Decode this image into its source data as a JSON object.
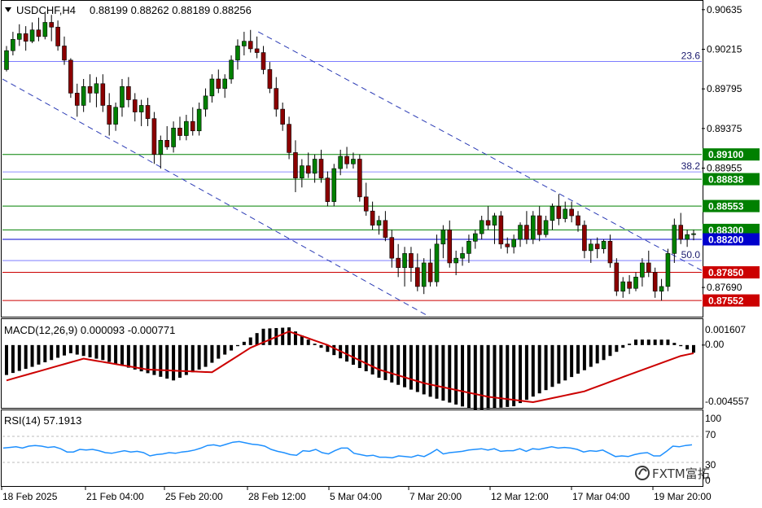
{
  "header": {
    "symbol": "USDCHF,H4",
    "ohlc": "0.88199 0.88262 0.88189 0.88256"
  },
  "macd_panel": {
    "title": "MACD(12,26,9) 0.000093 -0.000771",
    "axis_labels": [
      "0.001607",
      "0.00",
      "-0.004557"
    ]
  },
  "rsi_panel": {
    "title": "RSI(14) 57.1913",
    "axis_labels": [
      "100",
      "70",
      "30",
      "0"
    ]
  },
  "watermark": {
    "text": "FXTM富拓",
    "icon": "fxtm-logo-icon"
  },
  "colors": {
    "bull": "#008000",
    "bear": "#8b0000",
    "green_level": "#008000",
    "red_level": "#cc0000",
    "blue_level": "#0000cc",
    "macd_signal": "#cc0000",
    "rsi_line": "#1e90ff",
    "channel": "#2b3bb5"
  },
  "chart_data": [
    {
      "type": "candlestick",
      "title": "USDCHF,H4",
      "ylim": [
        0.8738,
        0.9072
      ],
      "price_ticks": [
        "0.90635",
        "0.90215",
        "0.89795",
        "0.89375",
        "0.88955",
        "0.87690"
      ],
      "time_labels": [
        "18 Feb 2025",
        "21 Feb 04:00",
        "25 Feb 20:00",
        "28 Feb 12:00",
        "5 Mar 04:00",
        "7 Mar 20:00",
        "12 Mar 12:00",
        "17 Mar 04:00",
        "19 Mar 20:00"
      ],
      "level_tags": [
        {
          "label": "0.89100",
          "value": 0.891,
          "color": "green"
        },
        {
          "label": "0.88838",
          "value": 0.88838,
          "color": "green"
        },
        {
          "label": "0.88553",
          "value": 0.88553,
          "color": "green"
        },
        {
          "label": "0.88300",
          "value": 0.883,
          "color": "green"
        },
        {
          "label": "0.88200",
          "value": 0.882,
          "color": "blue"
        },
        {
          "label": "0.87850",
          "value": 0.8785,
          "color": "red"
        },
        {
          "label": "0.87552",
          "value": 0.87552,
          "color": "red"
        }
      ],
      "fibonacci": [
        {
          "label": "23.6",
          "value": 0.90085
        },
        {
          "label": "38.2",
          "value": 0.88915
        },
        {
          "label": "50.0",
          "value": 0.87975
        }
      ],
      "channel_lines": [
        {
          "x1": 0.0,
          "y1": 0.899,
          "x2": 0.6105,
          "y2": 0.8738
        },
        {
          "x1": 0.3658,
          "y1": 0.904,
          "x2": 1.0,
          "y2": 0.8787
        }
      ],
      "candles": [
        [
          0.9,
          0.9025,
          0.8998,
          0.902
        ],
        [
          0.902,
          0.904,
          0.9015,
          0.9032
        ],
        [
          0.9032,
          0.9048,
          0.9025,
          0.9038
        ],
        [
          0.9038,
          0.9046,
          0.902,
          0.903
        ],
        [
          0.903,
          0.905,
          0.9028,
          0.9042
        ],
        [
          0.9042,
          0.9055,
          0.903,
          0.9035
        ],
        [
          0.9035,
          0.906,
          0.9032,
          0.905
        ],
        [
          0.905,
          0.9058,
          0.903,
          0.9045
        ],
        [
          0.9045,
          0.9052,
          0.902,
          0.9025
        ],
        [
          0.9025,
          0.9035,
          0.9005,
          0.901
        ],
        [
          0.901,
          0.9012,
          0.897,
          0.8975
        ],
        [
          0.8975,
          0.8985,
          0.895,
          0.8962
        ],
        [
          0.8962,
          0.899,
          0.8955,
          0.8982
        ],
        [
          0.8982,
          0.8995,
          0.8965,
          0.8975
        ],
        [
          0.8975,
          0.8992,
          0.896,
          0.8985
        ],
        [
          0.8985,
          0.8995,
          0.8955,
          0.8962
        ],
        [
          0.8962,
          0.8975,
          0.893,
          0.8942
        ],
        [
          0.8942,
          0.8965,
          0.8935,
          0.896
        ],
        [
          0.896,
          0.899,
          0.895,
          0.8982
        ],
        [
          0.8982,
          0.8992,
          0.896,
          0.8968
        ],
        [
          0.8968,
          0.8975,
          0.8945,
          0.8955
        ],
        [
          0.8955,
          0.8968,
          0.894,
          0.8962
        ],
        [
          0.8962,
          0.897,
          0.894,
          0.8948
        ],
        [
          0.8948,
          0.8955,
          0.89,
          0.891
        ],
        [
          0.891,
          0.893,
          0.8895,
          0.8925
        ],
        [
          0.8925,
          0.894,
          0.8915,
          0.8918
        ],
        [
          0.8918,
          0.8945,
          0.8912,
          0.8938
        ],
        [
          0.8938,
          0.895,
          0.8925,
          0.893
        ],
        [
          0.893,
          0.8952,
          0.8925,
          0.8945
        ],
        [
          0.8945,
          0.896,
          0.893,
          0.8935
        ],
        [
          0.8935,
          0.8965,
          0.893,
          0.8958
        ],
        [
          0.8958,
          0.898,
          0.895,
          0.8972
        ],
        [
          0.8972,
          0.8995,
          0.8965,
          0.899
        ],
        [
          0.899,
          0.9,
          0.8975,
          0.898
        ],
        [
          0.898,
          0.8995,
          0.897,
          0.899
        ],
        [
          0.899,
          0.9015,
          0.8985,
          0.901
        ],
        [
          0.901,
          0.9032,
          0.9,
          0.9025
        ],
        [
          0.9025,
          0.904,
          0.9015,
          0.903
        ],
        [
          0.903,
          0.9042,
          0.9018,
          0.9022
        ],
        [
          0.9022,
          0.9035,
          0.9012,
          0.9018
        ],
        [
          0.9018,
          0.9025,
          0.8995,
          0.9
        ],
        [
          0.9,
          0.9008,
          0.8975,
          0.898
        ],
        [
          0.898,
          0.8992,
          0.895,
          0.8958
        ],
        [
          0.8958,
          0.8965,
          0.8935,
          0.8942
        ],
        [
          0.8942,
          0.895,
          0.8905,
          0.8912
        ],
        [
          0.8912,
          0.8925,
          0.887,
          0.8885
        ],
        [
          0.8885,
          0.8905,
          0.8875,
          0.8898
        ],
        [
          0.8898,
          0.8912,
          0.8885,
          0.889
        ],
        [
          0.889,
          0.891,
          0.888,
          0.8905
        ],
        [
          0.8905,
          0.8915,
          0.888,
          0.8885
        ],
        [
          0.8885,
          0.8892,
          0.8855,
          0.886
        ],
        [
          0.886,
          0.89,
          0.8855,
          0.8895
        ],
        [
          0.8895,
          0.8915,
          0.8888,
          0.8908
        ],
        [
          0.8908,
          0.8918,
          0.8895,
          0.89
        ],
        [
          0.89,
          0.8912,
          0.8895,
          0.8905
        ],
        [
          0.8905,
          0.891,
          0.886,
          0.8865
        ],
        [
          0.8865,
          0.888,
          0.8845,
          0.885
        ],
        [
          0.885,
          0.886,
          0.883,
          0.8835
        ],
        [
          0.8835,
          0.8845,
          0.8825,
          0.884
        ],
        [
          0.884,
          0.885,
          0.8818,
          0.8822
        ],
        [
          0.8822,
          0.883,
          0.879,
          0.88
        ],
        [
          0.88,
          0.8815,
          0.878,
          0.879
        ],
        [
          0.879,
          0.8812,
          0.877,
          0.8805
        ],
        [
          0.8805,
          0.8812,
          0.8775,
          0.879
        ],
        [
          0.879,
          0.8805,
          0.8765,
          0.877
        ],
        [
          0.877,
          0.88,
          0.8762,
          0.8795
        ],
        [
          0.8795,
          0.881,
          0.877,
          0.8775
        ],
        [
          0.8775,
          0.8825,
          0.877,
          0.8815
        ],
        [
          0.8815,
          0.8835,
          0.88,
          0.883
        ],
        [
          0.883,
          0.884,
          0.879,
          0.8795
        ],
        [
          0.8795,
          0.8808,
          0.8782,
          0.88
        ],
        [
          0.88,
          0.8812,
          0.8792,
          0.8805
        ],
        [
          0.8805,
          0.8825,
          0.8795,
          0.8818
        ],
        [
          0.8818,
          0.883,
          0.881,
          0.8826
        ],
        [
          0.8826,
          0.8845,
          0.882,
          0.884
        ],
        [
          0.884,
          0.8855,
          0.883,
          0.8835
        ],
        [
          0.8835,
          0.8848,
          0.8815,
          0.8845
        ],
        [
          0.8845,
          0.885,
          0.881,
          0.8815
        ],
        [
          0.8815,
          0.8822,
          0.8805,
          0.8812
        ],
        [
          0.8812,
          0.8825,
          0.8805,
          0.882
        ],
        [
          0.882,
          0.8838,
          0.8812,
          0.8835
        ],
        [
          0.8835,
          0.885,
          0.8815,
          0.882
        ],
        [
          0.882,
          0.885,
          0.8815,
          0.8845
        ],
        [
          0.8845,
          0.8855,
          0.8818,
          0.8825
        ],
        [
          0.8825,
          0.8845,
          0.8822,
          0.884
        ],
        [
          0.884,
          0.8858,
          0.883,
          0.8855
        ],
        [
          0.8855,
          0.8868,
          0.8835,
          0.8842
        ],
        [
          0.8842,
          0.886,
          0.8838,
          0.8852
        ],
        [
          0.8852,
          0.886,
          0.8838,
          0.8845
        ],
        [
          0.8845,
          0.885,
          0.8828,
          0.8835
        ],
        [
          0.8835,
          0.884,
          0.88,
          0.8808
        ],
        [
          0.8808,
          0.882,
          0.8795,
          0.8815
        ],
        [
          0.8815,
          0.8822,
          0.88,
          0.881
        ],
        [
          0.881,
          0.882,
          0.8805,
          0.8818
        ],
        [
          0.8818,
          0.8825,
          0.879,
          0.8795
        ],
        [
          0.8795,
          0.88,
          0.876,
          0.8765
        ],
        [
          0.8765,
          0.878,
          0.8758,
          0.8775
        ],
        [
          0.8775,
          0.8782,
          0.8762,
          0.8768
        ],
        [
          0.8768,
          0.8785,
          0.8765,
          0.878
        ],
        [
          0.878,
          0.88,
          0.877,
          0.8795
        ],
        [
          0.8795,
          0.8808,
          0.878,
          0.8785
        ],
        [
          0.8785,
          0.879,
          0.8758,
          0.8765
        ],
        [
          0.8765,
          0.8778,
          0.8755,
          0.877
        ],
        [
          0.877,
          0.881,
          0.8765,
          0.8805
        ],
        [
          0.8805,
          0.8842,
          0.8795,
          0.8835
        ],
        [
          0.8835,
          0.8848,
          0.8815,
          0.882
        ],
        [
          0.882,
          0.883,
          0.8812,
          0.8825
        ],
        [
          0.8825,
          0.883,
          0.8819,
          0.8826
        ]
      ]
    },
    {
      "type": "bar",
      "title": "MACD(12,26,9) 0.000093 -0.000771",
      "ylim": [
        -0.004557,
        0.001607
      ],
      "hist_keyframes": [
        [
          0,
          -0.0022
        ],
        [
          4,
          -0.0016
        ],
        [
          10,
          -0.0006
        ],
        [
          15,
          -0.0011
        ],
        [
          20,
          -0.0018
        ],
        [
          26,
          -0.0026
        ],
        [
          31,
          -0.0016
        ],
        [
          35,
          -0.0004
        ],
        [
          40,
          0.0012
        ],
        [
          44,
          0.0013
        ],
        [
          50,
          -0.0005
        ],
        [
          58,
          -0.0024
        ],
        [
          66,
          -0.0038
        ],
        [
          73,
          -0.0048
        ],
        [
          79,
          -0.0045
        ],
        [
          87,
          -0.0026
        ],
        [
          93,
          -0.0011
        ],
        [
          98,
          0.0004
        ],
        [
          103,
          0.0004
        ],
        [
          108,
          -0.0008
        ],
        [
          113,
          -0.002
        ],
        [
          118,
          -0.0019
        ],
        [
          123,
          -0.0008
        ],
        [
          126,
          0.0001
        ],
        [
          127,
          0.0001
        ]
      ],
      "signal_keyframes": [
        [
          0,
          -0.0026
        ],
        [
          12,
          -0.001
        ],
        [
          22,
          -0.0018
        ],
        [
          32,
          -0.002
        ],
        [
          38,
          -0.0002
        ],
        [
          44,
          0.001
        ],
        [
          50,
          0.0
        ],
        [
          58,
          -0.0018
        ],
        [
          65,
          -0.0028
        ],
        [
          75,
          -0.0038
        ],
        [
          82,
          -0.0042
        ],
        [
          90,
          -0.0034
        ],
        [
          98,
          -0.002
        ],
        [
          105,
          -0.0008
        ],
        [
          110,
          -0.0003
        ],
        [
          118,
          -0.0012
        ],
        [
          123,
          -0.0015
        ],
        [
          126,
          -0.0008
        ],
        [
          127,
          -0.0008
        ]
      ]
    },
    {
      "type": "line",
      "title": "RSI(14) 57.1913",
      "ylim": [
        0,
        100
      ],
      "levels": [
        70,
        30
      ],
      "values": [
        52,
        53,
        54,
        52,
        55,
        56,
        55,
        53,
        54,
        51,
        46,
        46,
        50,
        49,
        50,
        48,
        45,
        44,
        46,
        48,
        46,
        47,
        45,
        40,
        42,
        43,
        45,
        44,
        46,
        47,
        49,
        52,
        56,
        57,
        55,
        58,
        61,
        62,
        60,
        58,
        57,
        55,
        50,
        47,
        45,
        42,
        41,
        48,
        47,
        50,
        45,
        43,
        48,
        52,
        52,
        44,
        42,
        40,
        41,
        38,
        38,
        37,
        40,
        39,
        38,
        41,
        39,
        44,
        50,
        43,
        45,
        46,
        47,
        49,
        50,
        51,
        49,
        51,
        47,
        48,
        48,
        51,
        47,
        51,
        50,
        52,
        54,
        52,
        53,
        52,
        50,
        46,
        48,
        47,
        49,
        44,
        39,
        40,
        39,
        42,
        44,
        45,
        40,
        40,
        47,
        55,
        54,
        56,
        57
      ]
    }
  ]
}
